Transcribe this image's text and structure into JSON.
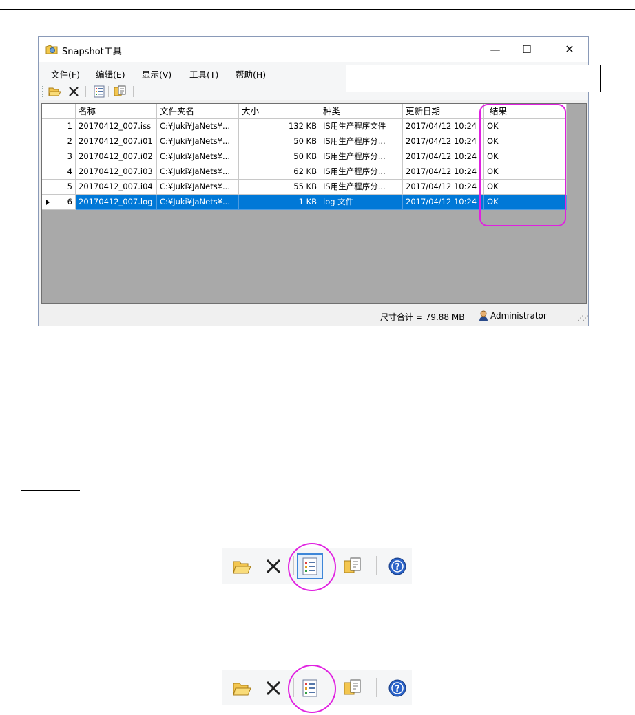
{
  "window": {
    "title": "Snapshot工具",
    "controls": {
      "minimize": "—",
      "maximize": "☐",
      "close": "✕"
    }
  },
  "menu": [
    "文件(F)",
    "编辑(E)",
    "显示(V)",
    "工具(T)",
    "帮助(H)"
  ],
  "table": {
    "headers": [
      "",
      "名称",
      "文件夹名",
      "大小",
      "种类",
      "更新日期",
      "结果"
    ],
    "rows": [
      [
        "1",
        "20170412_007.iss",
        "C:¥Juki¥JaNets¥...",
        "132 KB",
        "IS用生产程序文件",
        "2017/04/12 10:24",
        "OK"
      ],
      [
        "2",
        "20170412_007.i01",
        "C:¥Juki¥JaNets¥...",
        "50 KB",
        "IS用生产程序分...",
        "2017/04/12 10:24",
        "OK"
      ],
      [
        "3",
        "20170412_007.i02",
        "C:¥Juki¥JaNets¥...",
        "50 KB",
        "IS用生产程序分...",
        "2017/04/12 10:24",
        "OK"
      ],
      [
        "4",
        "20170412_007.i03",
        "C:¥Juki¥JaNets¥...",
        "62 KB",
        "IS用生产程序分...",
        "2017/04/12 10:24",
        "OK"
      ],
      [
        "5",
        "20170412_007.i04",
        "C:¥Juki¥JaNets¥...",
        "55 KB",
        "IS用生产程序分...",
        "2017/04/12 10:24",
        "OK"
      ],
      [
        "6",
        "20170412_007.log",
        "C:¥Juki¥JaNets¥...",
        "1 KB",
        "log 文件",
        "2017/04/12 10:24",
        "OK"
      ]
    ],
    "selected_row": 6
  },
  "status": {
    "size_total": "尺寸合计 = 79.88 MB",
    "user": "Administrator"
  },
  "icons": [
    "open-folder-icon",
    "delete-icon",
    "list-icon",
    "copy-icon",
    "help-icon",
    "user-icon"
  ],
  "colors": {
    "highlight": "#e020e0",
    "selection": "#0078d7",
    "grid_bg": "#a9a9a9"
  }
}
